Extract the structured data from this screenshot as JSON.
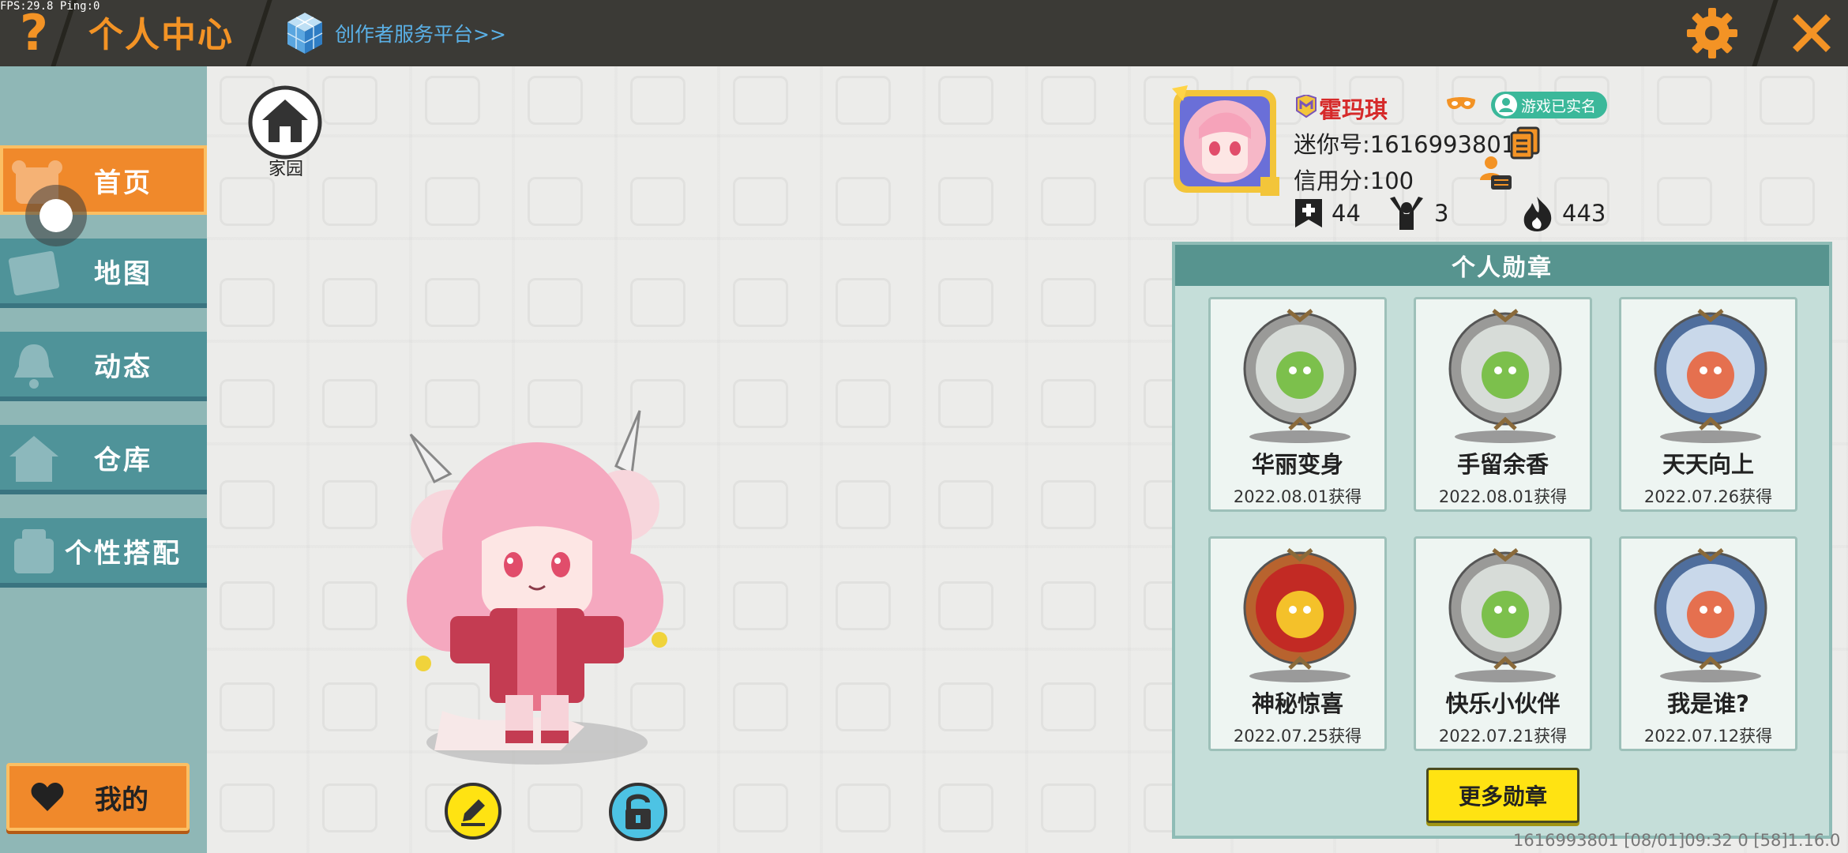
{
  "debug": {
    "fps": "FPS:29.8  Ping:0"
  },
  "header": {
    "help_icon": "question-mark-icon",
    "title": "个人中心",
    "creator_link": "创作者服务平台>>",
    "settings_icon": "gear-icon",
    "close_icon": "close-icon"
  },
  "sidebar": {
    "items": [
      {
        "label": "首页",
        "icon": "panda-icon",
        "active": true
      },
      {
        "label": "地图",
        "icon": "map-icon",
        "active": false
      },
      {
        "label": "动态",
        "icon": "bell-icon",
        "active": false
      },
      {
        "label": "仓库",
        "icon": "house-icon",
        "active": false
      },
      {
        "label": "个性搭配",
        "icon": "outfit-icon",
        "active": false
      }
    ],
    "mine_label": "我的"
  },
  "home": {
    "label": "家园"
  },
  "profile": {
    "username": "霍玛琪",
    "realname_badge": "游戏已实名",
    "mini_id": "迷你号:1616993801",
    "credit": "信用分:100",
    "stats": {
      "likes": "44",
      "fans": "3",
      "popularity": "443"
    }
  },
  "medals": {
    "title": "个人勋章",
    "items": [
      {
        "name": "华丽变身",
        "date": "2022.08.01获得",
        "icon": "dinosaur-medal-icon",
        "theme": "silver"
      },
      {
        "name": "手留余香",
        "date": "2022.08.01获得",
        "icon": "sprout-medal-icon",
        "theme": "silver"
      },
      {
        "name": "天天向上",
        "date": "2022.07.26获得",
        "icon": "calendar-medal-icon",
        "theme": "blue"
      },
      {
        "name": "神秘惊喜",
        "date": "2022.07.25获得",
        "icon": "gift-medal-icon",
        "theme": "red"
      },
      {
        "name": "快乐小伙伴",
        "date": "2022.07.21获得",
        "icon": "friends-medal-icon",
        "theme": "silver"
      },
      {
        "name": "我是谁?",
        "date": "2022.07.12获得",
        "icon": "card-medal-icon",
        "theme": "blue"
      }
    ],
    "more_label": "更多勋章"
  },
  "footer": {
    "info": "1616993801    [08/01]09:32 0   [58]1.16.0"
  },
  "colors": {
    "accent_orange": "#f39325",
    "sidebar_teal": "#4f9399",
    "panel_header": "#57948f",
    "name_red": "#d62a2a",
    "badge_green": "#3bb89a",
    "more_button": "#ffe312"
  }
}
